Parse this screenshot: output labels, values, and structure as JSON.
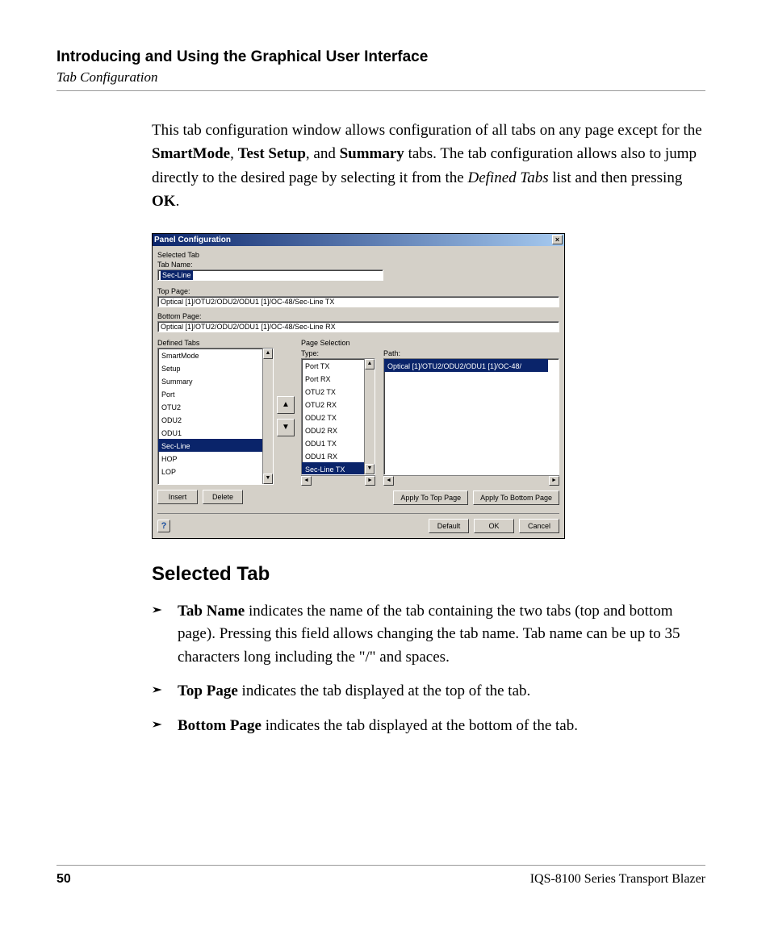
{
  "header": {
    "title": "Introducing and Using the Graphical User Interface",
    "subtitle": "Tab Configuration"
  },
  "intro": {
    "t1": "This tab configuration window allows configuration of all tabs on any page except for the ",
    "b1": "SmartMode",
    "t2": ", ",
    "b2": "Test Setup",
    "t3": ", and ",
    "b3": "Summary",
    "t4": " tabs. The tab configuration allows also to jump directly to the desired page by selecting it from the ",
    "i1": "Defined Tabs",
    "t5": " list and then pressing ",
    "b4": "OK",
    "t6": "."
  },
  "win": {
    "title": "Panel Configuration",
    "close": "×",
    "selected_tab_label": "Selected Tab",
    "tab_name_label": "Tab Name:",
    "tab_name_value": "Sec-Line",
    "top_page_label": "Top Page:",
    "top_page_value": "Optical [1]/OTU2/ODU2/ODU1 [1]/OC-48/Sec-Line TX",
    "bottom_page_label": "Bottom Page:",
    "bottom_page_value": "Optical [1]/OTU2/ODU2/ODU1 [1]/OC-48/Sec-Line RX",
    "defined_tabs_label": "Defined Tabs",
    "defined_tabs": [
      "SmartMode",
      "Setup",
      "Summary",
      "Port",
      "OTU2",
      "ODU2",
      "ODU1",
      "Sec-Line",
      "HOP",
      "LOP"
    ],
    "defined_tabs_selected": "Sec-Line",
    "insert_btn": "Insert",
    "delete_btn": "Delete",
    "page_selection_label": "Page Selection",
    "type_label": "Type:",
    "path_label": "Path:",
    "types": [
      "Port TX",
      "Port RX",
      "OTU2 TX",
      "OTU2 RX",
      "ODU2 TX",
      "ODU2 RX",
      "ODU1 TX",
      "ODU1 RX",
      "Sec-Line TX"
    ],
    "types_selected": "Sec-Line TX",
    "path_value": "Optical [1]/OTU2/ODU2/ODU1 [1]/OC-48/",
    "apply_top": "Apply To Top Page",
    "apply_bottom": "Apply To Bottom Page",
    "default_btn": "Default",
    "ok_btn": "OK",
    "cancel_btn": "Cancel",
    "up": "▲",
    "down": "▼",
    "left": "◄",
    "right": "►"
  },
  "section_heading": "Selected Tab",
  "bullets": {
    "b1a": "Tab Name",
    "b1b": " indicates the name of the tab containing the two tabs (top and bottom page). Pressing this field allows changing the tab name. Tab name can be up to 35 characters long including the \"/\" and spaces.",
    "b2a": "Top Page",
    "b2b": " indicates the tab displayed at the top of the tab.",
    "b3a": "Bottom Page",
    "b3b": " indicates the tab displayed at the bottom of the tab."
  },
  "footer": {
    "page": "50",
    "product": "IQS-8100 Series Transport Blazer"
  }
}
